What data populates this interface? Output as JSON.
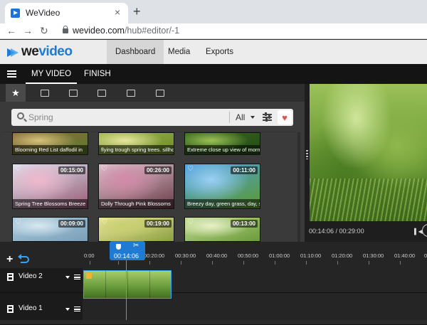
{
  "browser": {
    "tab_title": "WeVideo",
    "tab_close": "×",
    "new_tab": "+",
    "back": "←",
    "forward": "→",
    "reload": "↻",
    "url_host": "wevideo.com",
    "url_path": "/hub#editor/-1"
  },
  "app": {
    "logo_text": "we",
    "logo_text_b": "video",
    "nav": [
      "Dashboard",
      "Media",
      "Exports"
    ]
  },
  "editor": {
    "tabs": [
      "MY VIDEO",
      "FINISH"
    ]
  },
  "media": {
    "search_placeholder": "Spring",
    "filter_value": "All",
    "heart": "♥",
    "thumbs_row1": [
      {
        "caption": "Blooming Red List daffodil in",
        "colors": [
          "#8a6a3c",
          "#d6c27a",
          "#5f7a2c"
        ]
      },
      {
        "caption": "flying trough spring trees. sillho",
        "colors": [
          "#a0b84c",
          "#e8e6a0",
          "#6c8a2a"
        ]
      },
      {
        "caption": "Extreme close up view of morn...",
        "colors": [
          "#3a6a20",
          "#9cc256",
          "#244a14"
        ]
      }
    ],
    "thumbs_row2": [
      {
        "caption": "Spring Tree Blossoms Breeze",
        "duration": "00:15:00",
        "colors": [
          "#d7e6f2",
          "#f0b8cc",
          "#9a5a74"
        ]
      },
      {
        "caption": "Dolly Through Pink Blossoms",
        "duration": "00:26:00",
        "colors": [
          "#e0c9d2",
          "#d48aa8",
          "#6a3a48"
        ]
      },
      {
        "caption": "Breezy day, green grass, day, su...",
        "duration": "00:11:00",
        "colors": [
          "#4aa0e8",
          "#9ad0f6",
          "#5c9a2a"
        ]
      }
    ],
    "thumbs_row3": [
      {
        "duration": "00:09:00",
        "colors": [
          "#a8c8dc",
          "#d8e8f0",
          "#7aa0b8"
        ]
      },
      {
        "duration": "00:19:00",
        "colors": [
          "#f0e8a0",
          "#c8d070",
          "#8aa040"
        ]
      },
      {
        "duration": "00:13:00",
        "colors": [
          "#c0dc90",
          "#e8f0c8",
          "#6a9a3a"
        ]
      }
    ]
  },
  "preview": {
    "timecode": "00:14:06 / 00:29:00",
    "prev_frame": "▌◀"
  },
  "timeline": {
    "add": "+",
    "playhead_time": "00:14:06",
    "split_icon": "✂",
    "ticks": [
      "0:00",
      "00:10:00",
      "00:20:00",
      "00:30:00",
      "00:40:00",
      "00:50:00",
      "01:00:00",
      "01:10:00",
      "01:20:00",
      "01:30:00",
      "01:40:00",
      "01:50:00"
    ],
    "tracks": [
      {
        "name": "Video 2"
      },
      {
        "name": "Video 1"
      }
    ]
  },
  "colors": {
    "accent": "#1e7ad2",
    "favorite": "#e05050"
  }
}
